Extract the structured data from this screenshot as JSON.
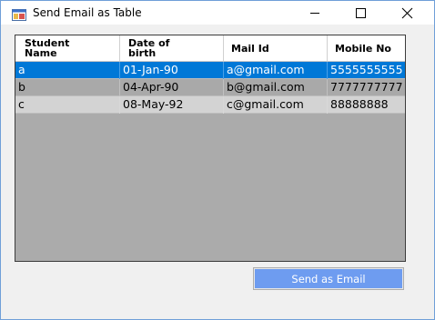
{
  "window": {
    "title": "Send Email as Table"
  },
  "grid": {
    "columns": [
      "Student\nName",
      "Date of\nbirth",
      "Mail Id",
      "Mobile No"
    ],
    "rows": [
      [
        "a",
        "01-Jan-90",
        "a@gmail.com",
        "5555555555"
      ],
      [
        "b",
        "04-Apr-90",
        "b@gmail.com",
        "7777777777"
      ],
      [
        "c",
        "08-May-92",
        "c@gmail.com",
        "88888888"
      ]
    ],
    "selected_row": 0
  },
  "actions": {
    "send_label": "Send as Email"
  },
  "colors": {
    "selection": "#0078d7",
    "button_fill": "#6e9cf0",
    "grid_background": "#ababab"
  }
}
